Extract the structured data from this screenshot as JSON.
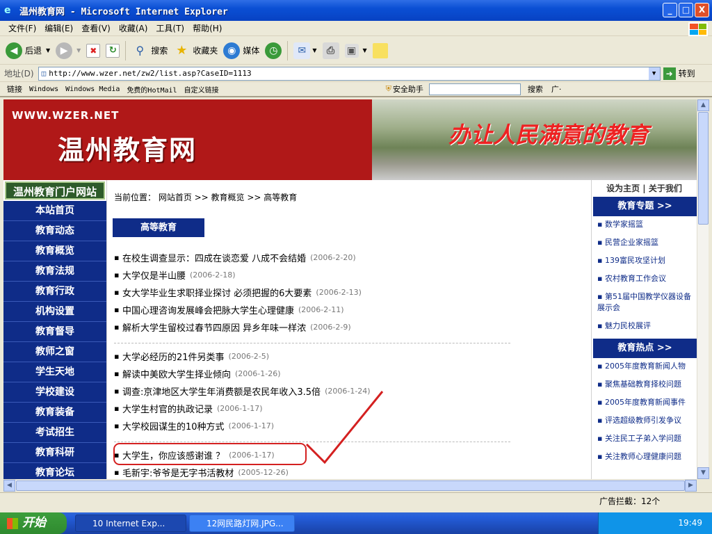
{
  "window": {
    "title": "温州教育网 - Microsoft Internet Explorer",
    "ie_icon": "e"
  },
  "window_buttons": [
    "_",
    "□",
    "X"
  ],
  "menu": [
    "文件(F)",
    "编辑(E)",
    "查看(V)",
    "收藏(A)",
    "工具(T)",
    "帮助(H)"
  ],
  "toolbar": {
    "back": "后退",
    "search": "搜索",
    "favorites": "收藏夹",
    "media": "媒体"
  },
  "address": {
    "label": "地址(D)",
    "url": "http://www.wzer.net/zw2/list.asp?CaseID=1113",
    "go": "转到"
  },
  "links": {
    "label": "链接",
    "items": [
      "Windows",
      "Windows Media",
      "免费的HotMail",
      "自定义链接"
    ],
    "security": "安全助手",
    "search": "搜索",
    "more": "广·"
  },
  "banner": {
    "url_text": "WWW.WZER.NET",
    "site_name": "温州教育网",
    "slogan": "办让人民满意的教育"
  },
  "leftnav": {
    "header": "温州教育门户网站",
    "items": [
      "本站首页",
      "教育动态",
      "教育概览",
      "教育法规",
      "教育行政",
      "机构设置",
      "教育督导",
      "教师之窗",
      "学生天地",
      "学校建设",
      "教育装备",
      "考试招生",
      "教育科研",
      "教育论坛"
    ]
  },
  "main": {
    "breadcrumb": "当前位置： 网站首页 >> 教育概览 >> 高等教育",
    "section_title": "高等教育",
    "group1": [
      {
        "title": "在校生调查显示：四成在谈恋爱 八成不会结婚",
        "date": "(2006-2-20)"
      },
      {
        "title": "大学仅是半山腰",
        "date": "(2006-2-18)"
      },
      {
        "title": "女大学毕业生求职择业探讨 必须把握的6大要素",
        "date": "(2006-2-13)"
      },
      {
        "title": "中国心理咨询发展峰会把脉大学生心理健康",
        "date": "(2006-2-11)"
      },
      {
        "title": "解析大学生留校过春节四原因 异乡年味一样浓",
        "date": "(2006-2-9)"
      }
    ],
    "group2": [
      {
        "title": "大学必经历的21件另类事",
        "date": "(2006-2-5)"
      },
      {
        "title": "解读中美欧大学生择业倾向",
        "date": "(2006-1-26)"
      },
      {
        "title": "调查:京津地区大学生年消费额是农民年收入3.5倍",
        "date": "(2006-1-24)"
      },
      {
        "title": "大学生村官的执政记录",
        "date": "(2006-1-17)"
      },
      {
        "title": "大学校园谋生的10种方式",
        "date": "(2006-1-17)"
      }
    ],
    "group3": [
      {
        "title": "大学生，你应该感谢谁 ？",
        "date": "(2006-1-17)"
      },
      {
        "title": "毛新宇:爷爷是无字书活教材",
        "date": "(2005-12-26)"
      }
    ]
  },
  "right": {
    "top_links": "设为主页 | 关于我们",
    "topics_header": "教育专题 >>",
    "topics": [
      "数学家摇篮",
      "民营企业家摇篮",
      "139富民攻坚计划",
      "农村教育工作会议",
      "第51届中国教学仪器设备展示会",
      "魅力民校展评"
    ],
    "hot_header": "教育热点 >>",
    "hot": [
      "2005年度教育新闻人物",
      "聚焦基础教育择校问题",
      "2005年度教育新闻事件",
      "评选超级教师引发争议",
      "关注民工子弟入学问题",
      "关注教师心理健康问题"
    ]
  },
  "status": {
    "blocked": "广告拦截：12个"
  },
  "taskbar": {
    "start": "开始",
    "tasks": [
      "10 Internet Exp...",
      "12网民路灯网.JPG..."
    ],
    "clock": "19:49"
  },
  "colors": {
    "nav_blue": "#0f2c88",
    "banner_red": "#b01818",
    "annotation_red": "#d42020"
  }
}
